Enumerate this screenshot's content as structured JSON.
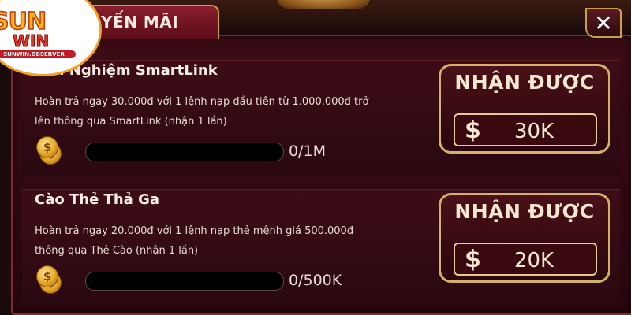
{
  "header": {
    "tab_label": "YẾN MÃI",
    "close_label": "✕"
  },
  "logo": {
    "brand_top": "SUN",
    "brand_bottom": "WIN",
    "site": "SUNWIN.OBSERVER"
  },
  "promotions": [
    {
      "title": "Trải Nghiệm SmartLink",
      "desc_line1": "Hoàn trả ngay 30.000đ với 1 lệnh nạp đầu tiên từ 1.000.000đ trở",
      "desc_line2": "lên thông qua SmartLink (nhận 1 lần)",
      "progress_text": "0/1M",
      "progress_fraction": 0,
      "reward_label": "NHẬN ĐƯỢC",
      "currency_symbol": "$",
      "reward_amount": "30K",
      "coin_icon": "coin-stack-icon"
    },
    {
      "title": "Cào Thẻ Thả Ga",
      "desc_line1": "Hoàn trả ngay 20.000đ với 1 lệnh nạp thẻ mệnh giá 500.000đ",
      "desc_line2": "thông qua Thẻ Cào (nhận 1 lần)",
      "progress_text": "0/500K",
      "progress_fraction": 0,
      "reward_label": "NHẬN ĐƯỢC",
      "currency_symbol": "$",
      "reward_amount": "20K",
      "coin_icon": "coin-stack-icon"
    }
  ],
  "colors": {
    "panel_bg": "#3b0c15",
    "gold_border": "#d4b06a",
    "progress_fill": "#f4b41a"
  }
}
